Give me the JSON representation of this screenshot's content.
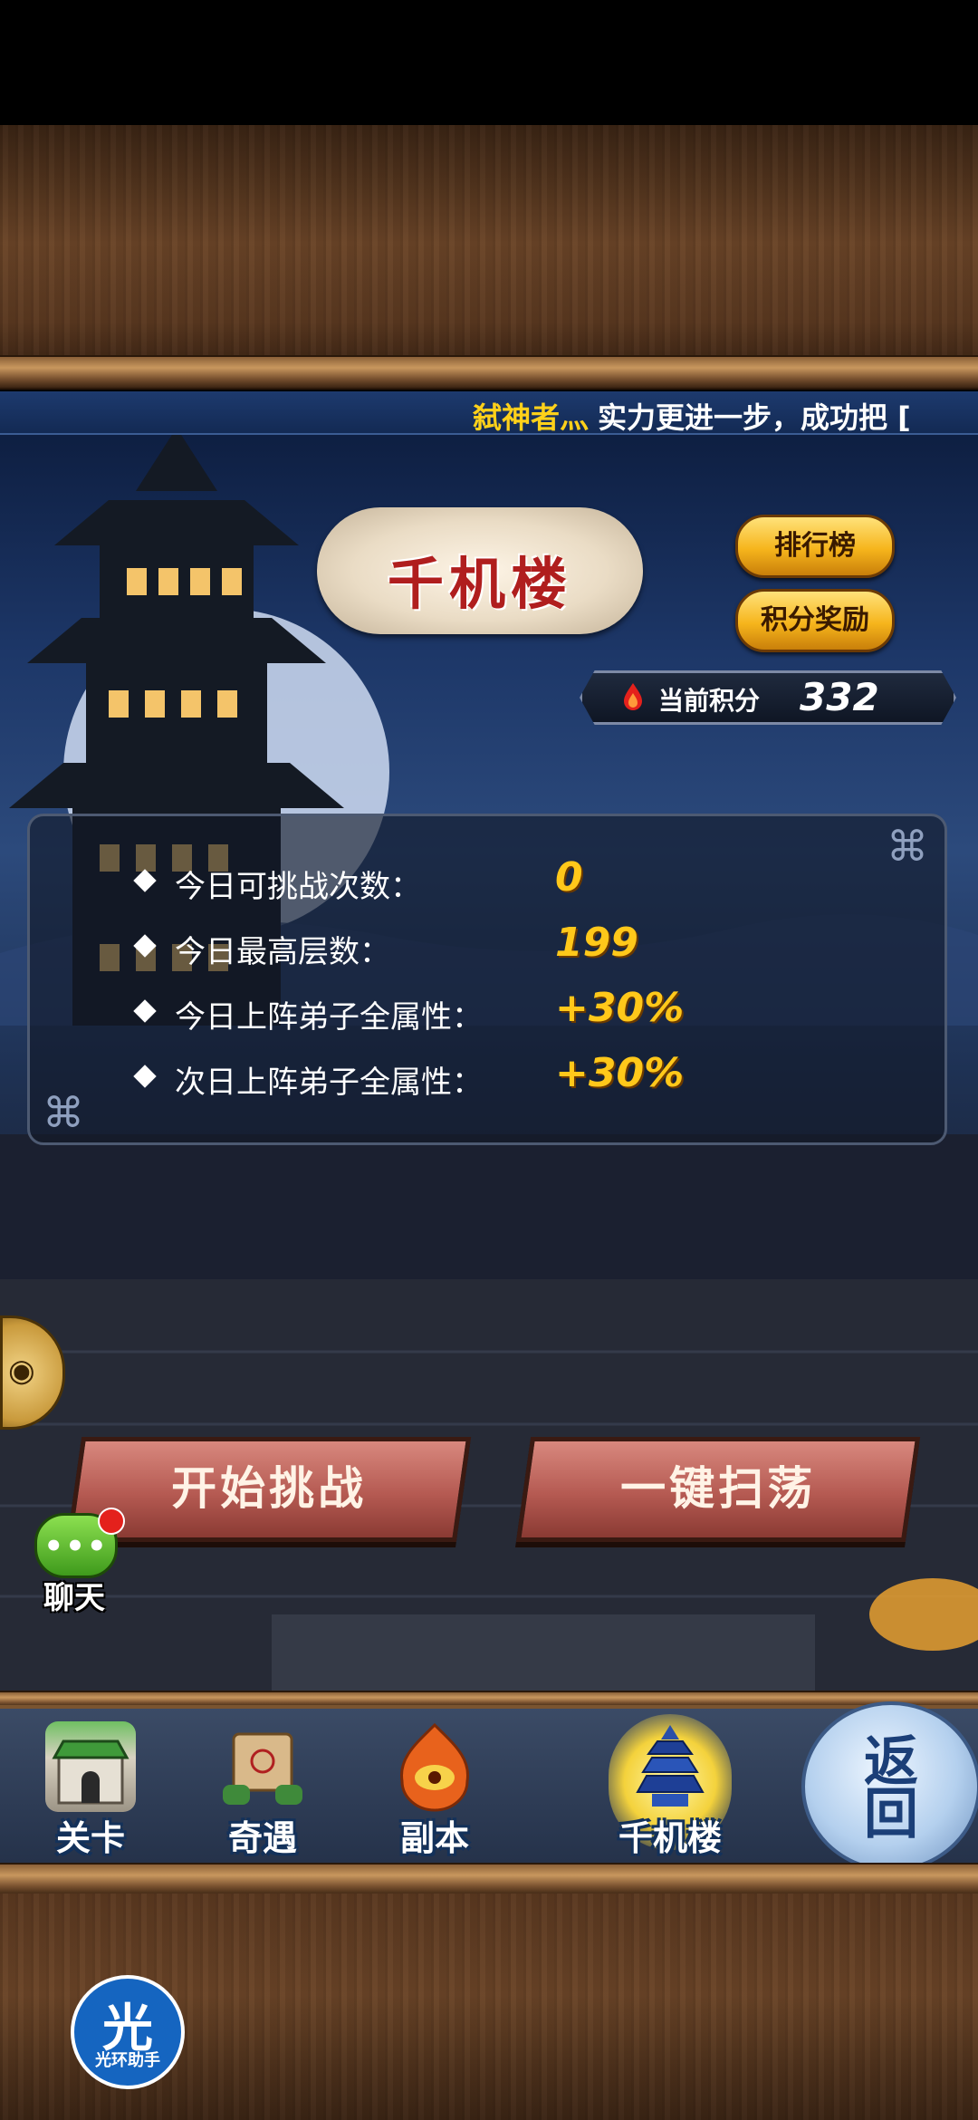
{
  "ticker": {
    "name": "弑神者灬",
    "message": "实力更进一步，成功把 ["
  },
  "banner": {
    "title": "千机楼"
  },
  "buttons": {
    "ranking": "排行榜",
    "reward": "积分奖励",
    "start": "开始挑战",
    "sweep": "一键扫荡"
  },
  "score": {
    "label": "当前积分",
    "value": "332"
  },
  "info": [
    {
      "label": "今日可挑战次数：",
      "value": "0"
    },
    {
      "label": "今日最高层数：",
      "value": "199"
    },
    {
      "label": "今日上阵弟子全属性：",
      "value": "+30%"
    },
    {
      "label": "次日上阵弟子全属性：",
      "value": "+30%"
    }
  ],
  "chat": {
    "label": "聊天",
    "dots": "•••"
  },
  "nav": [
    {
      "label": "关卡",
      "icon": "fortress-gate-icon"
    },
    {
      "label": "奇遇",
      "icon": "scroll-map-icon"
    },
    {
      "label": "副本",
      "icon": "flame-eye-icon"
    },
    {
      "label": "千机楼",
      "icon": "pagoda-icon",
      "active": true
    }
  ],
  "return_button": {
    "label": "返回"
  },
  "helper": {
    "glyph": "光",
    "label": "光环助手"
  },
  "colors": {
    "accent_gold": "#ffc81a",
    "ticker_name": "#ffd11a",
    "button_red": "#b55a52"
  }
}
